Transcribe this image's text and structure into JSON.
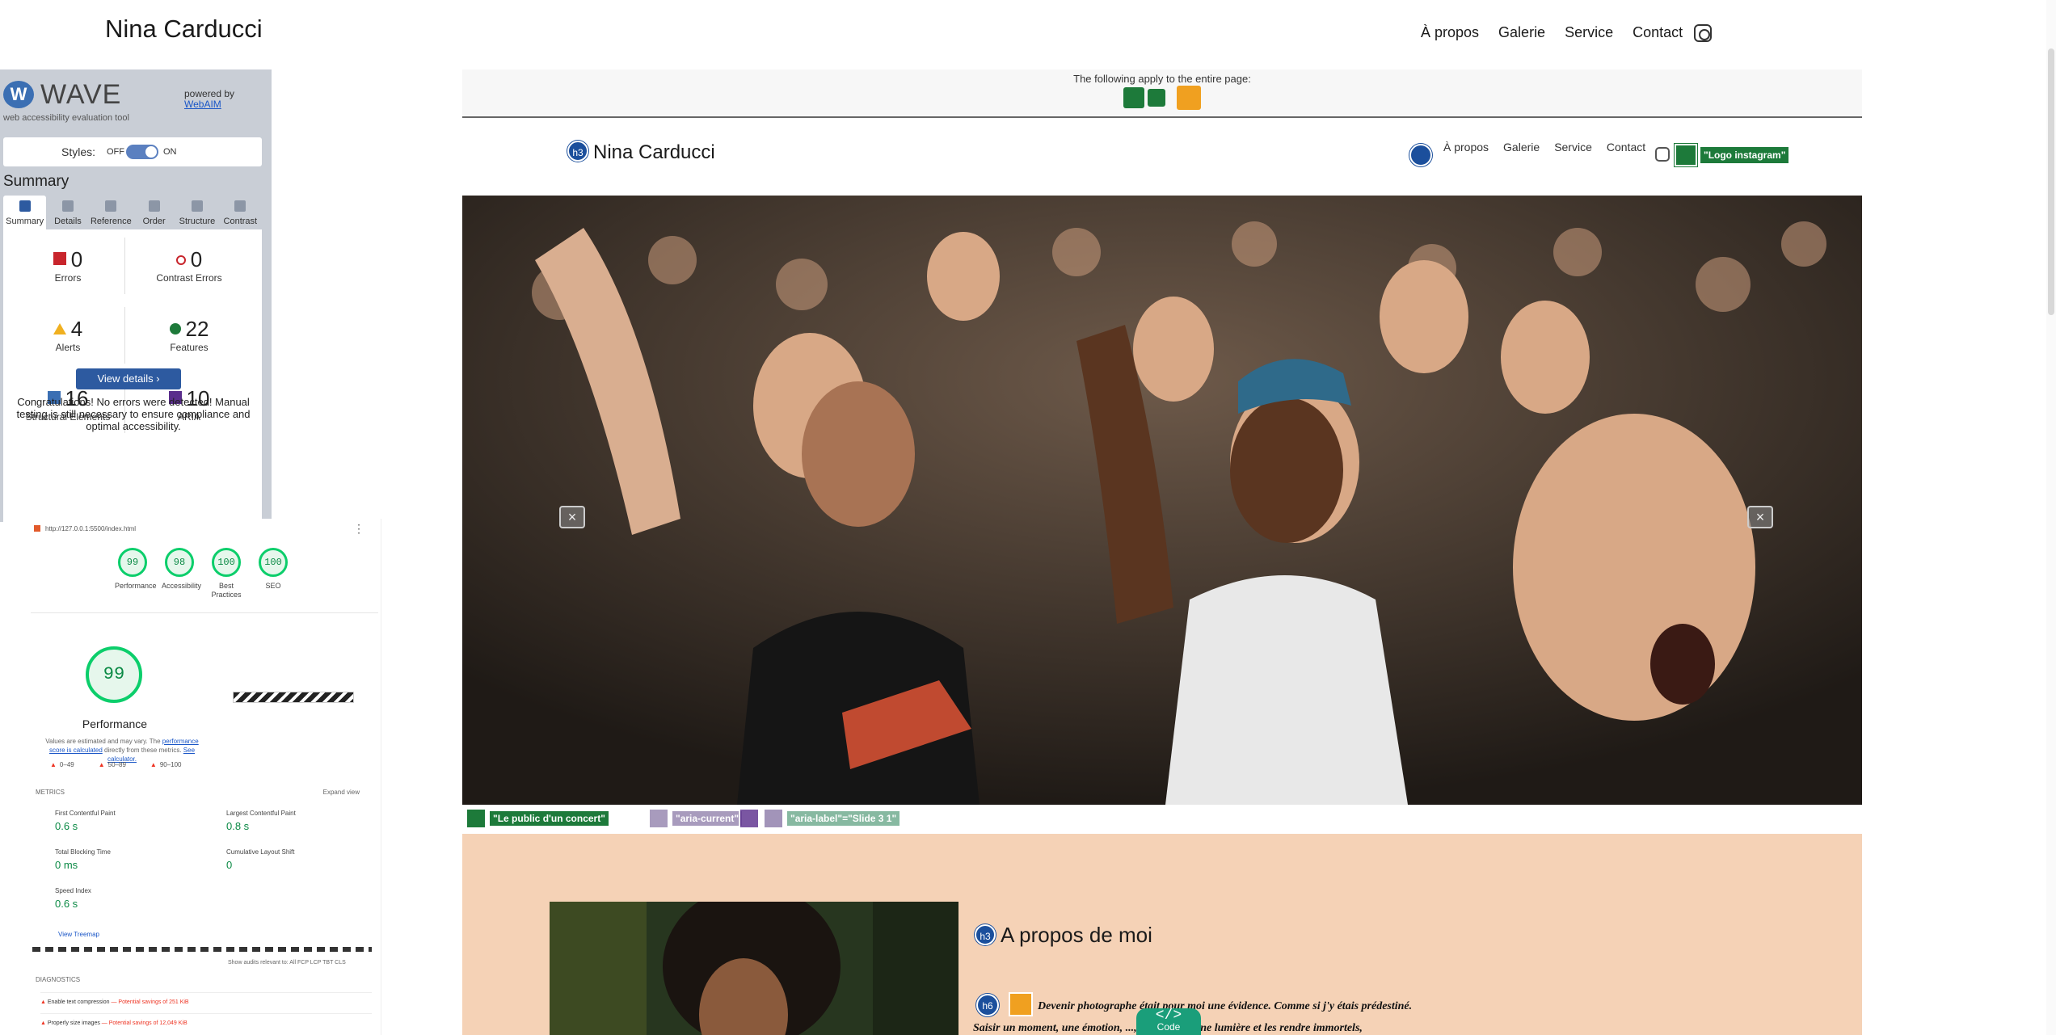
{
  "site": {
    "title": "Nina Carducci",
    "nav": [
      "À propos",
      "Galerie",
      "Service",
      "Contact"
    ],
    "instagram_icon": "instagram-icon"
  },
  "wave": {
    "logo": "WAVE",
    "subtitle": "web accessibility evaluation tool",
    "powered_by": "powered by",
    "powered_link": "WebAIM",
    "styles_label": "Styles:",
    "off": "OFF",
    "on": "ON",
    "summary_title": "Summary",
    "tabs": [
      "Summary",
      "Details",
      "Reference",
      "Order",
      "Structure",
      "Contrast"
    ],
    "stats": {
      "errors": {
        "value": "0",
        "label": "Errors"
      },
      "contrast": {
        "value": "0",
        "label": "Contrast Errors"
      },
      "alerts": {
        "value": "4",
        "label": "Alerts"
      },
      "features": {
        "value": "22",
        "label": "Features"
      },
      "structural": {
        "value": "16",
        "label": "Structural Elements"
      },
      "aria": {
        "value": "10",
        "label": "ARIA"
      }
    },
    "view_details": "View details ›",
    "congrats": "Congratulations! No errors were detected! Manual testing is still necessary to ensure compliance and optimal accessibility."
  },
  "lighthouse": {
    "url": "http://127.0.0.1:5500/index.html",
    "scores": [
      {
        "value": "99",
        "label": "Performance"
      },
      {
        "value": "98",
        "label": "Accessibility"
      },
      {
        "value": "100",
        "label": "Best Practices"
      },
      {
        "value": "100",
        "label": "SEO"
      }
    ],
    "main_score": "99",
    "main_label": "Performance",
    "note_a": "Values are estimated and may vary. The ",
    "note_link1": "performance score is calculated",
    "note_b": " directly from these metrics. ",
    "note_link2": "See calculator.",
    "legend": [
      "0–49",
      "50–89",
      "90–100"
    ],
    "metrics_head": "METRICS",
    "expand_view": "Expand view",
    "metrics": [
      {
        "label": "First Contentful Paint",
        "value": "0.6 s"
      },
      {
        "label": "Largest Contentful Paint",
        "value": "0.8 s"
      },
      {
        "label": "Total Blocking Time",
        "value": "0 ms"
      },
      {
        "label": "Cumulative Layout Shift",
        "value": "0"
      },
      {
        "label": "Speed Index",
        "value": "0.6 s"
      }
    ],
    "view_treemap": "View Treemap",
    "show_audits": "Show audits relevant to:  All  FCP  LCP  TBT  CLS",
    "diagnostics": "DIAGNOSTICS",
    "diag_items": [
      {
        "name": "Enable text compression",
        "saving": "— Potential savings of 251 KiB"
      },
      {
        "name": "Properly size images",
        "saving": "— Potential savings of 12,049 KiB"
      }
    ]
  },
  "page": {
    "applies_text": "The following apply to the entire page:",
    "inner_title": "Nina Carducci",
    "h3": "h3",
    "inner_nav": [
      "À propos",
      "Galerie",
      "Service",
      "Contact"
    ],
    "logo_tag": "\"Logo instagram\"",
    "caption_tags": [
      {
        "text": "\"Le public d'un concert\"",
        "color": "#1d7a3a"
      },
      {
        "text": "\"aria-current\"",
        "color": "#8c7aa8"
      },
      {
        "text": "\"aria-label\"=\"Slide 3 1\"",
        "color": "#6aa88a"
      }
    ],
    "about_title": "A propos de moi",
    "h6": "h6",
    "about_line1": "Devenir photographe était pour moi une évidence. Comme si j'y étais prédestiné.",
    "about_line2": "Saisir un moment, une émotion, ..., un endroit, une lumière et les rendre immortels,",
    "code_label": "Code",
    "code_glyph": "</>"
  },
  "colors": {
    "accent_blue": "#2d5aa0",
    "feature_green": "#1d7a3a",
    "about_bg": "#f5d2b6",
    "score_green": "#0cce6b"
  }
}
